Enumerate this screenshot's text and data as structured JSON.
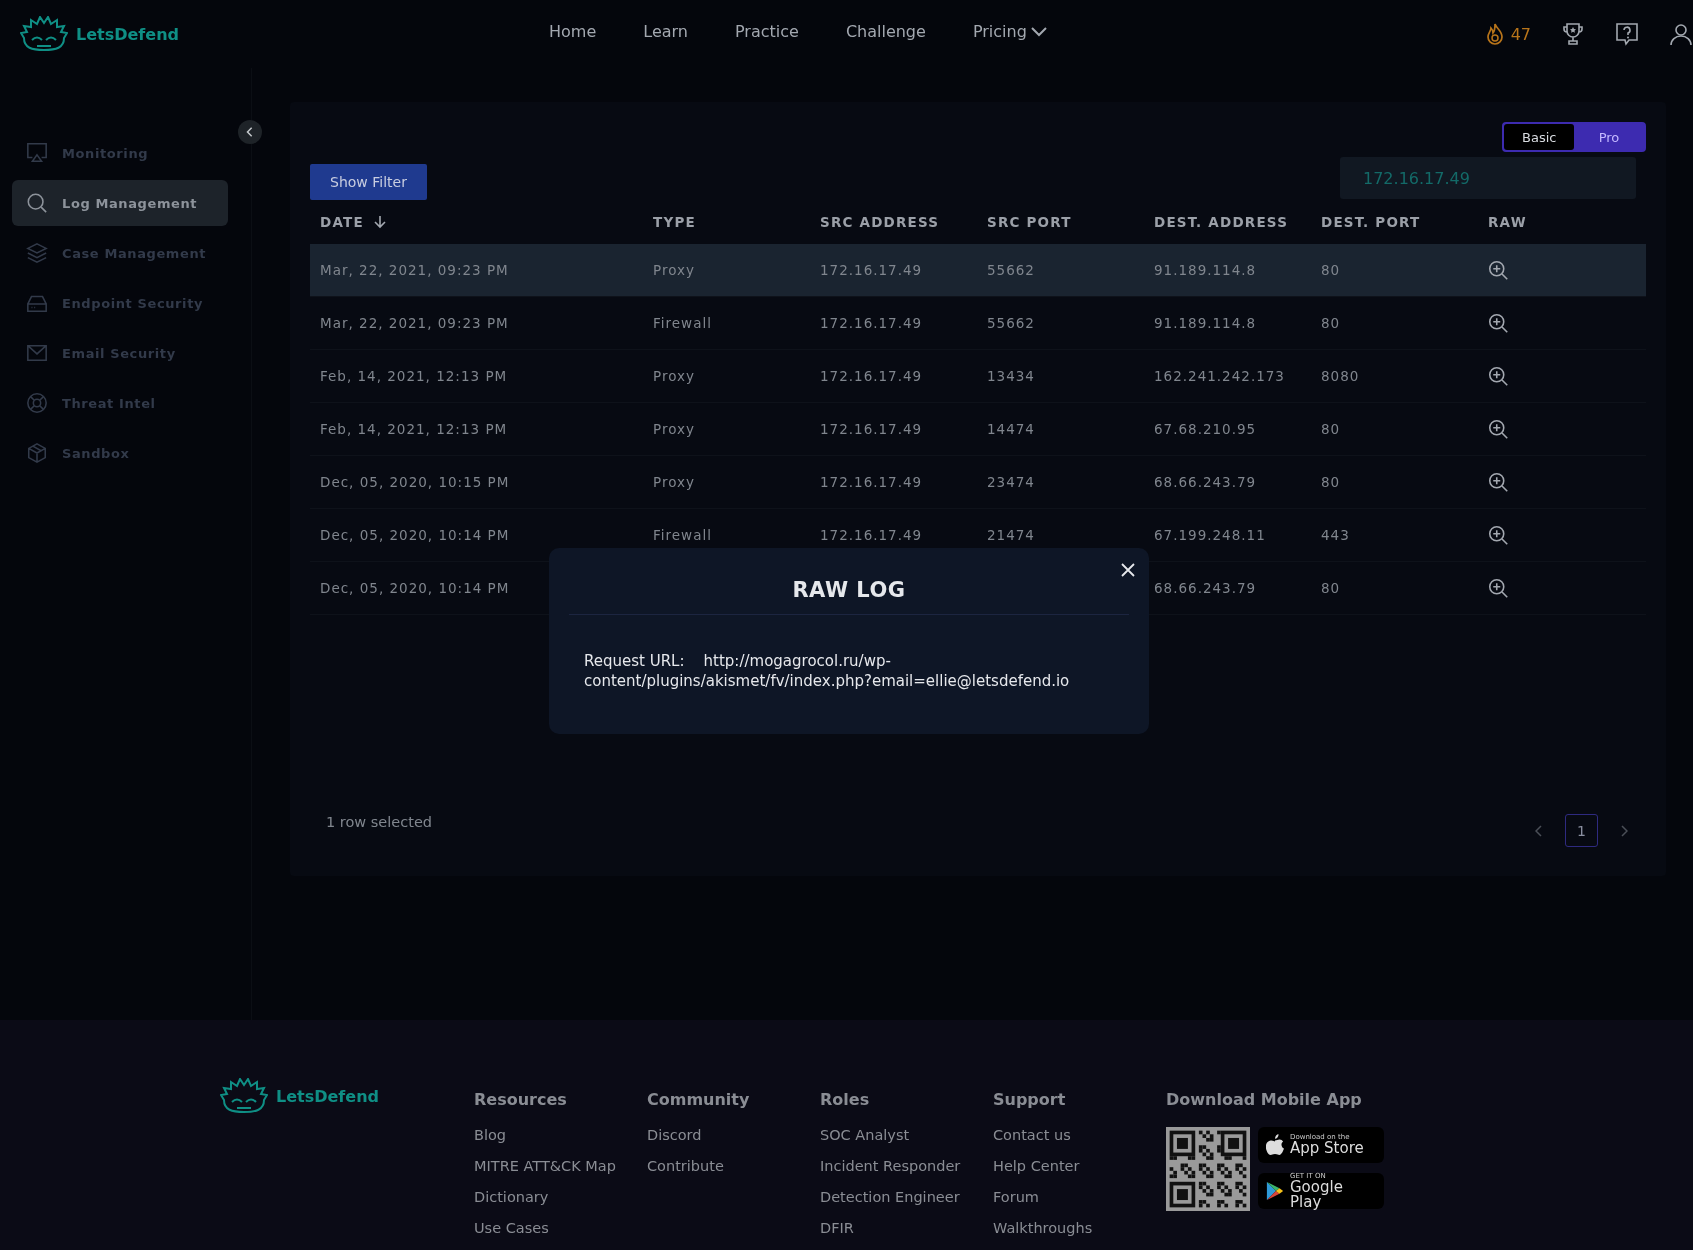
{
  "header": {
    "brand": "LetsDefend",
    "nav": [
      {
        "label": "Home",
        "dropdown": false
      },
      {
        "label": "Learn",
        "dropdown": false
      },
      {
        "label": "Practice",
        "dropdown": false
      },
      {
        "label": "Challenge",
        "dropdown": false
      },
      {
        "label": "Pricing",
        "dropdown": true
      }
    ],
    "streak": "47"
  },
  "sidebar": {
    "items": [
      {
        "label": "Monitoring",
        "selected": false
      },
      {
        "label": "Log Management",
        "selected": true
      },
      {
        "label": "Case Management",
        "selected": false
      },
      {
        "label": "Endpoint Security",
        "selected": false
      },
      {
        "label": "Email Security",
        "selected": false
      },
      {
        "label": "Threat Intel",
        "selected": false
      },
      {
        "label": "Sandbox",
        "selected": false
      }
    ]
  },
  "panel": {
    "mode_toggle": [
      {
        "label": "Basic",
        "selected": true
      },
      {
        "label": "Pro",
        "selected": false
      }
    ],
    "filter_button": "Show Filter",
    "search": {
      "value": "172.16.17.49"
    },
    "table": {
      "columns": [
        "DATE",
        "TYPE",
        "SRC ADDRESS",
        "SRC PORT",
        "DEST. ADDRESS",
        "DEST. PORT",
        "RAW"
      ],
      "rows": [
        {
          "selected": true,
          "cells": [
            "Mar, 22, 2021, 09:23 PM",
            "Proxy",
            "172.16.17.49",
            "55662",
            "91.189.114.8",
            "80"
          ]
        },
        {
          "selected": false,
          "cells": [
            "Mar, 22, 2021, 09:23 PM",
            "Firewall",
            "172.16.17.49",
            "55662",
            "91.189.114.8",
            "80"
          ]
        },
        {
          "selected": false,
          "cells": [
            "Feb, 14, 2021, 12:13 PM",
            "Proxy",
            "172.16.17.49",
            "13434",
            "162.241.242.173",
            "8080"
          ]
        },
        {
          "selected": false,
          "cells": [
            "Feb, 14, 2021, 12:13 PM",
            "Proxy",
            "172.16.17.49",
            "14474",
            "67.68.210.95",
            "80"
          ]
        },
        {
          "selected": false,
          "cells": [
            "Dec, 05, 2020, 10:15 PM",
            "Proxy",
            "172.16.17.49",
            "23474",
            "68.66.243.79",
            "80"
          ]
        },
        {
          "selected": false,
          "cells": [
            "Dec, 05, 2020, 10:14 PM",
            "Firewall",
            "172.16.17.49",
            "21474",
            "67.199.248.11",
            "443"
          ]
        },
        {
          "selected": false,
          "cells": [
            "Dec, 05, 2020, 10:14 PM",
            null,
            null,
            null,
            "68.66.243.79",
            "80"
          ]
        }
      ]
    },
    "selection_status": "1 row selected",
    "pagination": {
      "pages": [
        {
          "label": "1",
          "selected": true
        }
      ]
    }
  },
  "modal": {
    "title": "RAW LOG",
    "label": "Request URL:",
    "value": "http://mogagrocol.ru/wp-content/plugins/akismet/fv/index.php?email=ellie@letsdefend.io"
  },
  "footer": {
    "brand": "LetsDefend",
    "columns": [
      {
        "heading": "Resources",
        "links": [
          "Blog",
          "MITRE ATT&CK Map",
          "Dictionary",
          "Use Cases"
        ]
      },
      {
        "heading": "Community",
        "links": [
          "Discord",
          "Contribute"
        ]
      },
      {
        "heading": "Roles",
        "links": [
          "SOC Analyst",
          "Incident Responder",
          "Detection Engineer",
          "DFIR"
        ]
      },
      {
        "heading": "Support",
        "links": [
          "Contact us",
          "Help Center",
          "Forum",
          "Walkthroughs"
        ]
      }
    ],
    "app": {
      "heading": "Download Mobile App",
      "stores": [
        {
          "kind": "apple",
          "small": "Download on the",
          "big": "App Store"
        },
        {
          "kind": "google",
          "small": "GET IT ON",
          "big": "Google Play"
        }
      ]
    }
  }
}
